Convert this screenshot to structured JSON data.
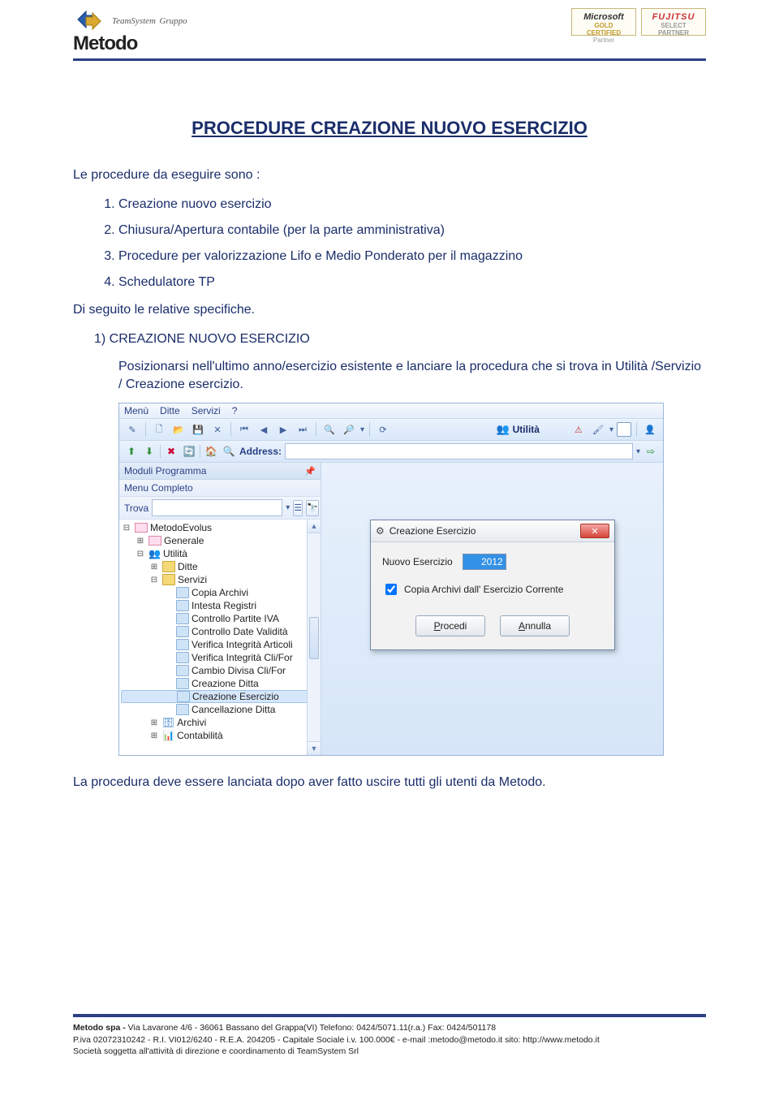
{
  "header": {
    "brand": "Metodo",
    "teamsystem": "TeamSystem",
    "teamsystem_sub": "Gruppo",
    "badge_ms_line1": "Microsoft",
    "badge_ms_line2": "GOLD CERTIFIED",
    "badge_ms_line3": "Partner",
    "badge_fj_line1": "FUJITSU",
    "badge_fj_line2": "SELECT PARTNER"
  },
  "doc": {
    "title": "PROCEDURE CREAZIONE NUOVO ESERCIZIO",
    "intro": "Le procedure da eseguire sono :",
    "steps": [
      "Creazione nuovo esercizio",
      "Chiusura/Apertura contabile (per la parte amministrativa)",
      "Procedure per valorizzazione Lifo e Medio Ponderato per il magazzino",
      "Schedulatore TP"
    ],
    "followup": "Di seguito le relative specifiche.",
    "section1_title": "1) CREAZIONE NUOVO ESERCIZIO",
    "section1_body": "Posizionarsi nell'ultimo anno/esercizio esistente e lanciare la procedura che si trova in Utilità /Servizio / Creazione esercizio.",
    "post_text": "La procedura deve essere lanciata dopo aver fatto uscire tutti gli utenti da Metodo."
  },
  "app": {
    "menu": {
      "m1": "Menù",
      "m2": "Ditte",
      "m3": "Servizi",
      "m4": "?"
    },
    "toolbar": {
      "utilita": "Utilità"
    },
    "address_label": "Address:",
    "sidebar": {
      "head": "Moduli Programma",
      "menu_completo": "Menu Completo",
      "trova": "Trova"
    },
    "tree": {
      "root": "MetodoEvolus",
      "n_generale": "Generale",
      "n_utilita": "Utilità",
      "n_ditte": "Ditte",
      "n_servizi": "Servizi",
      "items": [
        "Copia Archivi",
        "Intesta Registri",
        "Controllo Partite IVA",
        "Controllo Date Validità",
        "Verifica Integrità Articoli",
        "Verifica Integrità Cli/For",
        "Cambio Divisa Cli/For",
        "Creazione Ditta",
        "Creazione Esercizio",
        "Cancellazione Ditta"
      ],
      "n_archivi": "Archivi",
      "n_contabilita": "Contabilità"
    },
    "dialog": {
      "title": "Creazione Esercizio",
      "nuovo_label": "Nuovo Esercizio",
      "nuovo_value": "2012",
      "chk_label": "Copia Archivi dall' Esercizio Corrente",
      "btn_procedi_pre": "P",
      "btn_procedi_rest": "rocedi",
      "btn_annulla_pre": "A",
      "btn_annulla_rest": "nnulla"
    }
  },
  "footer": {
    "l1a": "Metodo spa  -  ",
    "l1b": "Via Lavarone 4/6 - 36061 Bassano del Grappa(VI) Telefono: 0424/5071.11(r.a.) Fax: 0424/501178",
    "l2": "P.iva 02072310242 - R.I. VI012/6240 - R.E.A. 204205 - Capitale Sociale i.v. 100.000€ - e-mail :metodo@metodo.it sito: http://www.metodo.it",
    "l3": "Società soggetta all'attività di direzione e coordinamento di TeamSystem Srl"
  }
}
